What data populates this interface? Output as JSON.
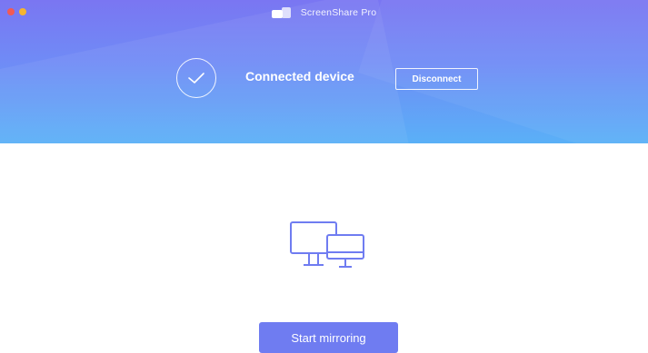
{
  "app": {
    "title": "ScreenShare Pro",
    "icon": "app-logo-icon"
  },
  "window_controls": {
    "close_color": "#f25a55",
    "minimize_color": "#f5b52f"
  },
  "status": {
    "icon": "check-circle-icon",
    "text": "Connected device",
    "disconnect_label": "Disconnect"
  },
  "main": {
    "illustration_icon": "desktop-monitors-icon",
    "start_label": "Start mirroring"
  },
  "colors": {
    "header_gradient_top": "#7a76f2",
    "header_gradient_bottom": "#5ab0f7",
    "accent": "#6f7cf1",
    "illustration_stroke": "#6f7cf1"
  }
}
